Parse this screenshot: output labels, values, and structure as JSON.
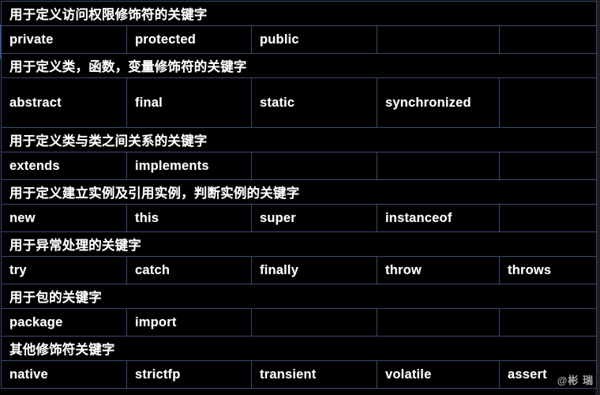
{
  "document": {
    "type": "reference-table",
    "subject": "Java 关键字",
    "columns": 5
  },
  "colors": {
    "background": "#000000",
    "grid_border": "#3b4a72",
    "text": "#ffffff",
    "left_accent": "#1f6fd0",
    "right_gutter": "#211d24",
    "watermark": "#cfcfd6"
  },
  "table": {
    "groups": [
      {
        "section": "用于定义访问权限修饰符的关键字",
        "tall": false,
        "keywords": [
          "private",
          "protected",
          "public",
          "",
          ""
        ]
      },
      {
        "section": "用于定义类，函数，变量修饰符的关键字",
        "tall": true,
        "keywords": [
          "abstract",
          "final",
          "static",
          "synchronized",
          ""
        ]
      },
      {
        "section": "用于定义类与类之间关系的关键字",
        "tall": false,
        "keywords": [
          "extends",
          "implements",
          "",
          "",
          ""
        ]
      },
      {
        "section": "用于定义建立实例及引用实例，判断实例的关键字",
        "tall": false,
        "keywords": [
          "new",
          "this",
          "super",
          "instanceof",
          ""
        ]
      },
      {
        "section": "用于异常处理的关键字",
        "tall": false,
        "keywords": [
          "try",
          "catch",
          "finally",
          "throw",
          "throws"
        ]
      },
      {
        "section": "用于包的关键字",
        "tall": false,
        "keywords": [
          "package",
          "import",
          "",
          "",
          ""
        ]
      },
      {
        "section": "其他修饰符关键字",
        "tall": false,
        "keywords": [
          "native",
          "strictfp",
          "transient",
          "volatile",
          "assert"
        ]
      }
    ]
  },
  "watermark": {
    "text": "@彬 瑞"
  }
}
